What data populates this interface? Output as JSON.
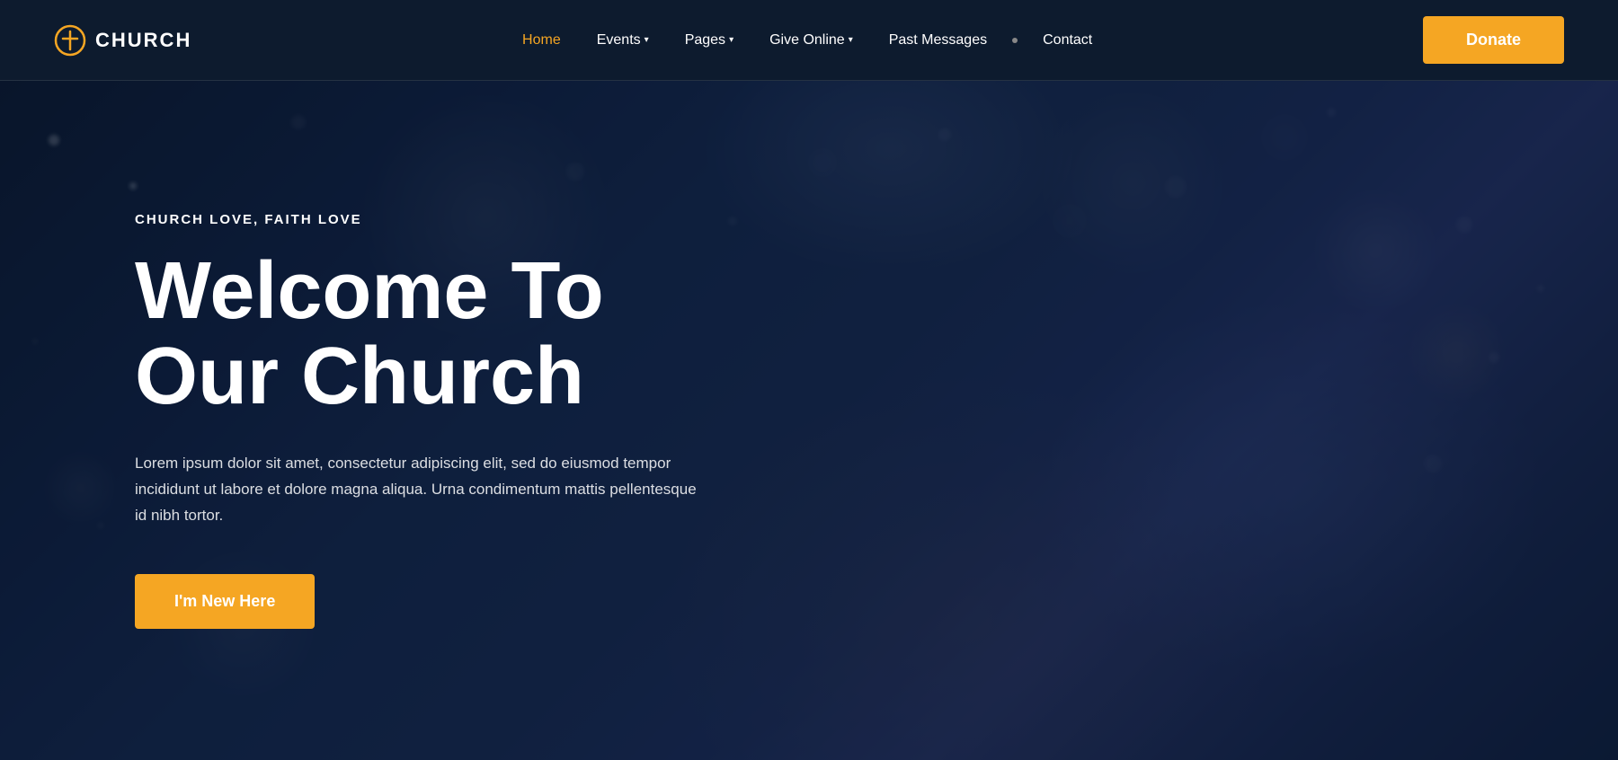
{
  "header": {
    "logo_text": "CHURCH",
    "logo_icon": "cross-circle-icon",
    "nav": [
      {
        "label": "Home",
        "active": true,
        "has_dropdown": false
      },
      {
        "label": "Events",
        "active": false,
        "has_dropdown": true
      },
      {
        "label": "Pages",
        "active": false,
        "has_dropdown": true
      },
      {
        "label": "Give Online",
        "active": false,
        "has_dropdown": true
      },
      {
        "label": "Past Messages",
        "active": false,
        "has_dropdown": false
      },
      {
        "label": "Contact",
        "active": false,
        "has_dropdown": false
      }
    ],
    "donate_label": "Donate"
  },
  "hero": {
    "eyebrow": "CHURCH LOVE, FAITH LOVE",
    "title_line1": "Welcome To",
    "title_line2": "Our Church",
    "description": "Lorem ipsum dolor sit amet, consectetur adipiscing elit, sed do eiusmod tempor incididunt ut labore et dolore magna aliqua. Urna condimentum mattis pellentesque id nibh tortor.",
    "cta_label": "I'm New Here"
  },
  "colors": {
    "accent": "#f5a623",
    "nav_bg": "#0d1b2e",
    "hero_bg": "#0f2040",
    "white": "#ffffff"
  }
}
